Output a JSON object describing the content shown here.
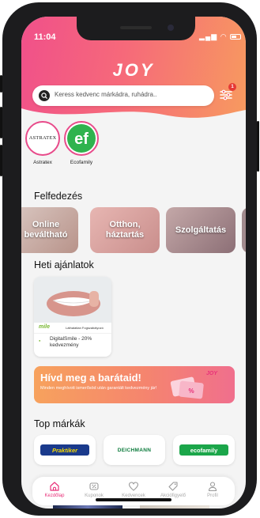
{
  "status": {
    "time": "11:04"
  },
  "app": {
    "logo": "JOY"
  },
  "search": {
    "placeholder": "Keress kedvenc márkádra, ruhádra..",
    "filter_badge": "1"
  },
  "favorites": [
    {
      "name": "Astratex",
      "logo_text": "ASTRATEX"
    },
    {
      "name": "Ecofamily",
      "logo_text": "ef"
    }
  ],
  "sections": {
    "discover": "Felfedezés",
    "weekly": "Heti ajánlatok",
    "top_brands": "Top márkák"
  },
  "categories": [
    {
      "label": "Online beváltható"
    },
    {
      "label": "Otthon, háztartás"
    },
    {
      "label": "Szolgáltatás"
    }
  ],
  "weekly_offer": {
    "brand_mark": "mile",
    "strip_text": "Láthatatlan Fogszabályozó",
    "title": "DigitalSmile - 20% kedvezmény"
  },
  "banner": {
    "title": "Hívd meg a barátaid!",
    "subtitle": "Minden meghívott ismerősöd után garantált kedvezmény jár!",
    "logo": "JOY"
  },
  "brands": [
    {
      "name": "Praktiker",
      "bg": "#1a3a8c",
      "fg": "#f5d800"
    },
    {
      "name": "DEICHMANN",
      "bg": "#ffffff",
      "fg": "#0b7a3b"
    },
    {
      "name": "ecofamily",
      "bg": "#1ba64a",
      "fg": "#ffffff"
    }
  ],
  "tabs": [
    {
      "label": "Kezdőlap",
      "icon": "home-icon",
      "active": true
    },
    {
      "label": "Kuponok",
      "icon": "coupon-icon",
      "active": false
    },
    {
      "label": "Kedvencek",
      "icon": "heart-icon",
      "active": false
    },
    {
      "label": "Akciófigyelő",
      "icon": "tag-icon",
      "active": false
    },
    {
      "label": "Profil",
      "icon": "user-icon",
      "active": false
    }
  ],
  "colors": {
    "accent": "#e8327a",
    "header_start": "#f0508a",
    "header_end": "#f79a5f"
  }
}
